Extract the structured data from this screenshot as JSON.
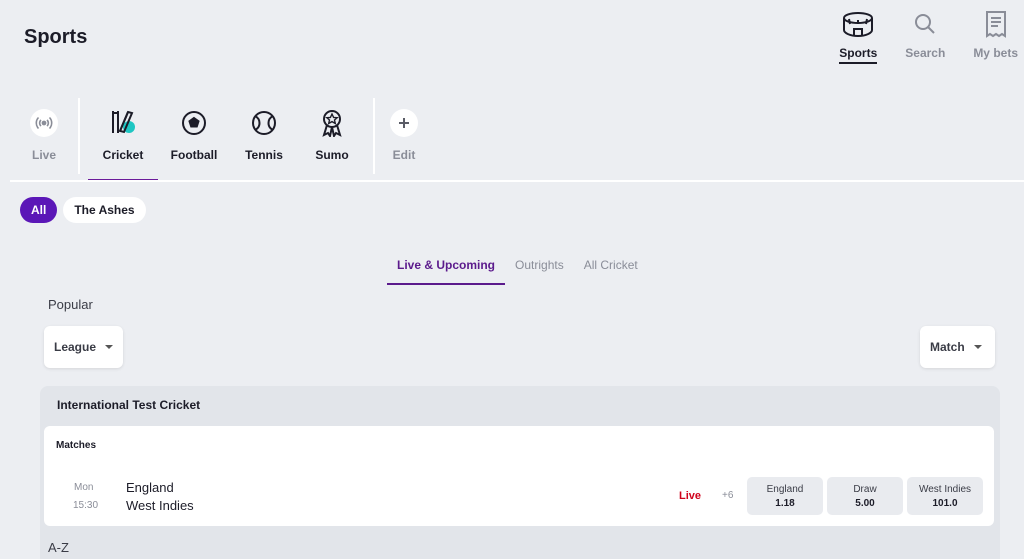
{
  "header": {
    "title": "Sports"
  },
  "top_nav": [
    {
      "label": "Sports",
      "icon": "stadium-icon",
      "active": true
    },
    {
      "label": "Search",
      "icon": "search-icon"
    },
    {
      "label": "My bets",
      "icon": "betslip-icon"
    }
  ],
  "sport_bar": {
    "live_label": "Live",
    "sports": [
      {
        "label": "Cricket",
        "icon": "cricket-icon",
        "active": true
      },
      {
        "label": "Football",
        "icon": "football-icon"
      },
      {
        "label": "Tennis",
        "icon": "tennis-icon"
      },
      {
        "label": "Sumo",
        "icon": "sumo-icon"
      }
    ],
    "edit_label": "Edit",
    "accent_color": "#6b1a9a"
  },
  "chips": [
    {
      "label": "All",
      "active": true
    },
    {
      "label": "The Ashes"
    }
  ],
  "tabs": [
    {
      "label": "Live & Upcoming",
      "active": true
    },
    {
      "label": "Outrights"
    },
    {
      "label": "All Cricket"
    }
  ],
  "popular_label": "Popular",
  "filters": {
    "league": "League",
    "match": "Match"
  },
  "league": {
    "title": "International Test Cricket",
    "matches_title": "Matches",
    "match": {
      "day": "Mon",
      "time": "15:30",
      "team1": "England",
      "team2": "West Indies",
      "status": "Live",
      "more_markets": "+6",
      "odds": [
        {
          "label": "England",
          "value": "1.18"
        },
        {
          "label": "Draw",
          "value": "5.00"
        },
        {
          "label": "West Indies",
          "value": "101.0"
        }
      ]
    }
  },
  "az_label": "A-Z",
  "colors": {
    "primary": "#5b17b7",
    "live": "#d0021b",
    "background": "#eceef2"
  }
}
